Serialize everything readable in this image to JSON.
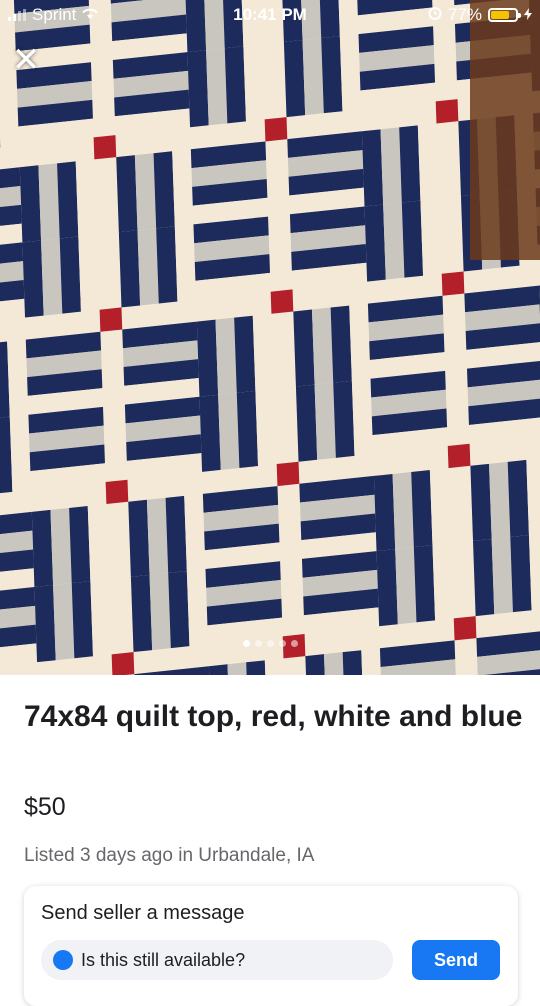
{
  "status_bar": {
    "carrier": "Sprint",
    "time": "10:41 PM",
    "battery": "77%",
    "battery_level": 0.77,
    "battery_color": "#f5c400",
    "icons": [
      "signal-icon",
      "wifi-icon",
      "alarm-icon",
      "battery-icon",
      "charging-icon"
    ]
  },
  "photo": {
    "close_glyph": "✕",
    "carousel_count": 5,
    "carousel_active_index": 0,
    "quilt_colors": {
      "navy": "#1d2a5c",
      "cream": "#f3e9d6",
      "red": "#b4202a",
      "plaid": "#c9c6c0"
    }
  },
  "listing": {
    "title": "74x84 quilt top, red, white and blue",
    "price": "$50",
    "listed": "Listed 3 days ago in Urbandale, IA"
  },
  "message_card": {
    "heading": "Send seller a message",
    "input_value": "Is this still available?",
    "send_label": "Send",
    "accent": "#1877f2"
  }
}
